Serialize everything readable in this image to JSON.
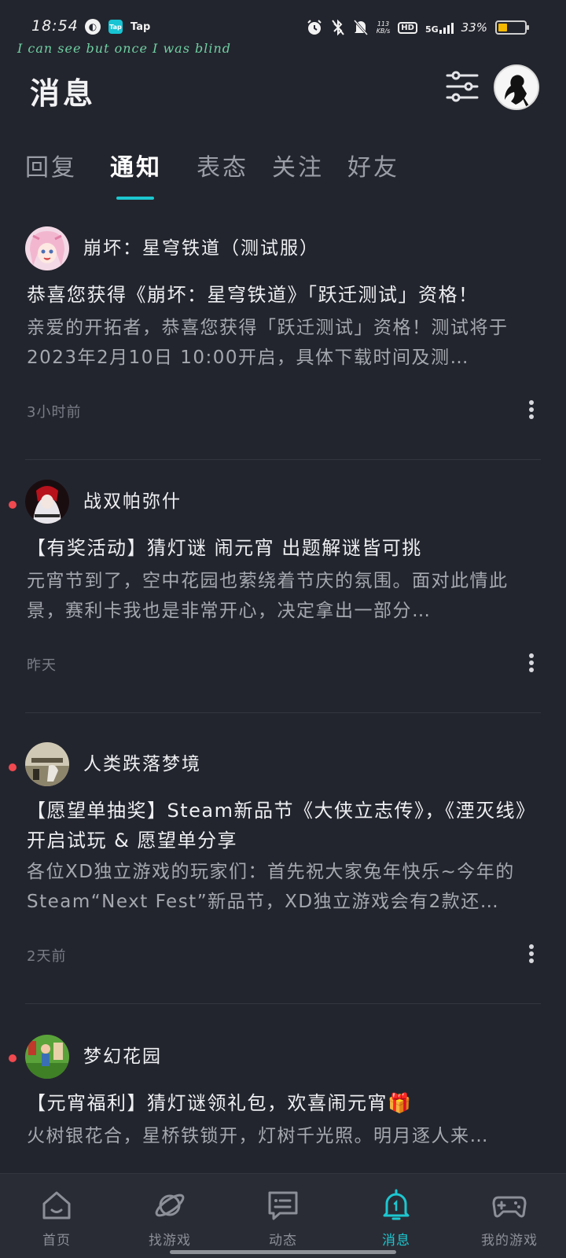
{
  "status_bar": {
    "time": "18:54",
    "tap_label": "Tap",
    "net_speed_value": "113",
    "net_speed_unit": "KB/s",
    "hd": "HD",
    "network": "5G",
    "battery": "33%",
    "battery_level": 0.33,
    "tagline": "I can see  but once I was blind"
  },
  "header": {
    "title": "消息"
  },
  "tabs": [
    {
      "label": "回复",
      "active": false
    },
    {
      "label": "通知",
      "active": true
    },
    {
      "label": "表态",
      "active": false
    },
    {
      "label": "关注",
      "active": false
    },
    {
      "label": "好友",
      "active": false
    }
  ],
  "notifications": [
    {
      "sender": "崩坏：星穹铁道（测试服）",
      "title": "恭喜您获得《崩坏：星穹铁道》「跃迁测试」资格！",
      "body": "亲爱的开拓者，恭喜您获得「跃迁测试」资格！测试将于2023年2月10日 10:00开启，具体下载时间及测…",
      "time": "3小时前",
      "unread": false
    },
    {
      "sender": "战双帕弥什",
      "title": "【有奖活动】猜灯谜 闹元宵 出题解谜皆可挑",
      "body": "元宵节到了，空中花园也萦绕着节庆的氛围。面对此情此景，赛利卡我也是非常开心，决定拿出一部分…",
      "time": "昨天",
      "unread": true
    },
    {
      "sender": "人类跌落梦境",
      "title": "【愿望单抽奖】Steam新品节《大侠立志传》，《湮灭线》开启试玩 & 愿望单分享",
      "body": "各位XD独立游戏的玩家们：首先祝大家兔年快乐~今年的Steam“Next Fest”新品节，XD独立游戏会有2款还…",
      "time": "2天前",
      "unread": true
    },
    {
      "sender": "梦幻花园",
      "title": "【元宵福利】猜灯谜领礼包，欢喜闹元宵🎁",
      "body": "火树银花合，星桥铁锁开，灯树千光照。明月逐人来…",
      "time": "",
      "unread": true
    }
  ],
  "bottom_nav": [
    {
      "label": "首页",
      "icon": "home-icon",
      "active": false
    },
    {
      "label": "找游戏",
      "icon": "planet-icon",
      "active": false
    },
    {
      "label": "动态",
      "icon": "chat-icon",
      "active": false
    },
    {
      "label": "消息",
      "icon": "bell-icon",
      "active": true
    },
    {
      "label": "我的游戏",
      "icon": "gamepad-icon",
      "active": false
    }
  ],
  "colors": {
    "background": "#23252e",
    "accent": "#1cc7d0",
    "unread_dot": "#f0494f"
  }
}
